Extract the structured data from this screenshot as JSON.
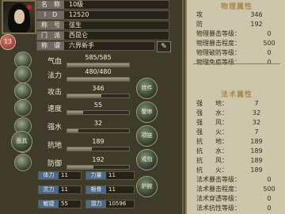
{
  "character": {
    "level": "13",
    "info": [
      {
        "label": "名　称",
        "value": "10级"
      },
      {
        "label": "I　D",
        "value": "12520"
      },
      {
        "label": "称　号",
        "value": "弦生"
      },
      {
        "label": "门　派",
        "value": "西昆仑"
      },
      {
        "label": "称　谓",
        "value": "六界新手"
      }
    ],
    "edit_icon": "pencil-icon"
  },
  "stats": [
    {
      "label": "气血",
      "value": "585/585",
      "fill": 1.0
    },
    {
      "label": "法力",
      "value": "480/480",
      "fill": 1.0
    },
    {
      "label": "攻击",
      "value": "346",
      "fill": 0.55
    },
    {
      "label": "速度",
      "value": "55",
      "fill": 0.25
    },
    {
      "label": "强水",
      "value": "32",
      "fill": 0.18
    },
    {
      "label": "抗地",
      "value": "189",
      "fill": 0.4
    },
    {
      "label": "防御",
      "value": "192",
      "fill": 0.42
    }
  ],
  "side_buttons": {
    "buttons": [
      {
        "label": "挂件"
      },
      {
        "label": "警审"
      },
      {
        "label": "面具"
      },
      {
        "label": "项链"
      },
      {
        "label": "戒指"
      },
      {
        "label": "护腕"
      }
    ]
  },
  "attributes_grid": [
    {
      "label": "体力",
      "value": "11"
    },
    {
      "label": "力量",
      "value": "11"
    },
    {
      "label": "灵力",
      "value": "11"
    },
    {
      "label": "根骨",
      "value": "11"
    },
    {
      "label": "敏捷",
      "value": "55"
    },
    {
      "label": "潜力",
      "value": "10596"
    }
  ],
  "right_panel": {
    "physical_title": "物理属性",
    "physical": [
      {
        "label": "攻",
        "value": "346"
      },
      {
        "label": "防",
        "value": "192"
      },
      {
        "label": "物理暴击等级：",
        "value": "0"
      },
      {
        "label": "物理暴击程度：",
        "value": "500"
      },
      {
        "label": "物理破防等级：",
        "value": "0"
      },
      {
        "label": "物理免疫等级：",
        "value": "0"
      }
    ],
    "magic_title": "法术属性",
    "magic": [
      {
        "label": "强　　地：",
        "value": "7"
      },
      {
        "label": "强　　水：",
        "value": "32"
      },
      {
        "label": "强　　风：",
        "value": "32"
      },
      {
        "label": "强　　火：",
        "value": "7"
      },
      {
        "label": "抗　　地：",
        "value": "189"
      },
      {
        "label": "抗　　水：",
        "value": "189"
      },
      {
        "label": "抗　　风：",
        "value": "189"
      },
      {
        "label": "抗　　火：",
        "value": "189"
      },
      {
        "label": "法术暴击等级：",
        "value": "0"
      },
      {
        "label": "法术暴击程度：",
        "value": "500"
      },
      {
        "label": "法术穿透等级：",
        "value": "0"
      },
      {
        "label": "法术抗性等级：",
        "value": "0"
      }
    ]
  },
  "colors": {
    "left_bg": "#3f3b2a",
    "right_bg": "#cdc6aa",
    "section_title": "#a28b4b",
    "bar_fill": "#8c8878"
  }
}
